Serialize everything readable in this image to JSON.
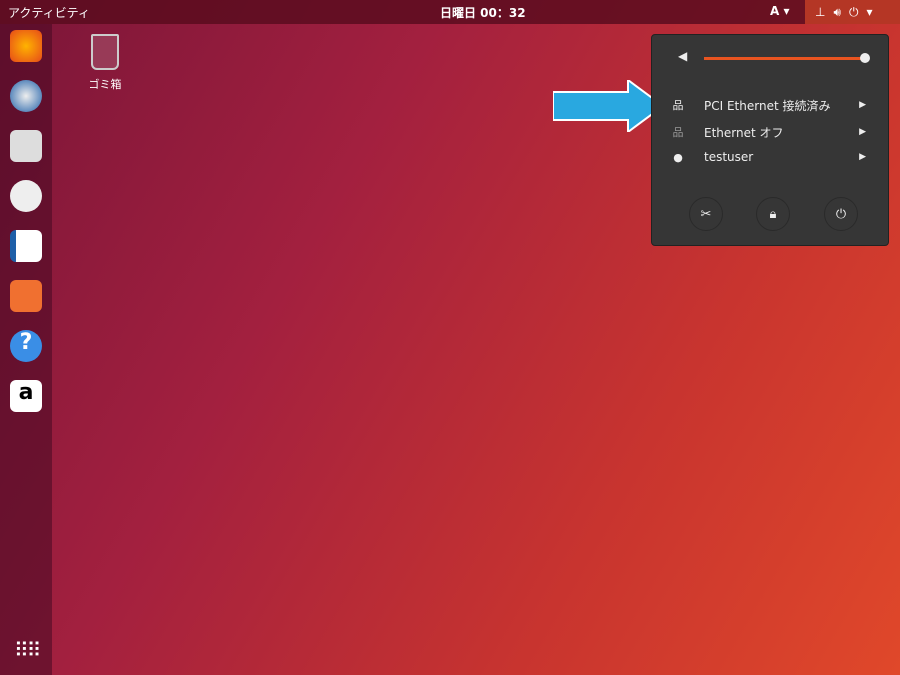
{
  "topbar": {
    "activities": "アクティビティ",
    "clock": "日曜日 00：32",
    "input_method": "A ▾"
  },
  "desktop": {
    "trash_label": "ゴミ箱"
  },
  "menu": {
    "items": [
      {
        "label": "PCI Ethernet 接続済み",
        "icon": "network-wired-icon"
      },
      {
        "label": "Ethernet オフ",
        "icon": "network-offline-icon"
      },
      {
        "label": "testuser",
        "icon": "user-icon"
      }
    ],
    "volume": 1.0
  },
  "colors": {
    "accent": "#e95420",
    "arrow": "#29a8e0"
  }
}
